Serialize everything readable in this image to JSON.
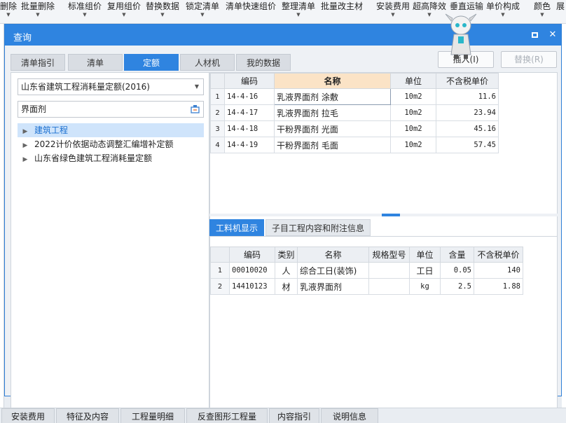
{
  "ribbon": {
    "items": [
      {
        "label": "删除",
        "caret": true
      },
      {
        "label": "批量删除",
        "caret": true
      },
      {
        "label": "标准组价",
        "caret": true
      },
      {
        "label": "复用组价",
        "caret": true
      },
      {
        "label": "替换数据",
        "caret": true
      },
      {
        "label": "锁定清单",
        "caret": true
      },
      {
        "label": "清单快速组价",
        "caret": false
      },
      {
        "label": "整理清单",
        "caret": true
      },
      {
        "label": "批量改主材",
        "caret": false
      },
      {
        "label": "安装费用",
        "caret": true
      },
      {
        "label": "超高降效",
        "caret": true
      },
      {
        "label": "垂直运输",
        "caret": false
      },
      {
        "label": "单价构成",
        "caret": true
      },
      {
        "label": "颜色",
        "caret": true
      },
      {
        "label": "展",
        "caret": false
      }
    ]
  },
  "dialog": {
    "title": "查询",
    "tabs": [
      "清单指引",
      "清单",
      "定额",
      "人材机",
      "我的数据"
    ],
    "active_tab": "定额",
    "insert_button": "插入(I)",
    "replace_button": "替换(R)",
    "library_select": "山东省建筑工程消耗量定额(2016)",
    "search_value": "界面剂",
    "tree": [
      {
        "label": "建筑工程",
        "selected": true
      },
      {
        "label": "2022计价依据动态调整汇编增补定额",
        "selected": false
      },
      {
        "label": "山东省绿色建筑工程消耗量定额",
        "selected": false
      }
    ],
    "grid1": {
      "headers": [
        "",
        "编码",
        "名称",
        "单位",
        "不含税单价"
      ],
      "rows": [
        {
          "idx": "1",
          "code": "14-4-16",
          "name": "乳液界面剂 涂敷",
          "unit": "10m2",
          "price": "11.6"
        },
        {
          "idx": "2",
          "code": "14-4-17",
          "name": "乳液界面剂 拉毛",
          "unit": "10m2",
          "price": "23.94"
        },
        {
          "idx": "3",
          "code": "14-4-18",
          "name": "干粉界面剂 光面",
          "unit": "10m2",
          "price": "45.16"
        },
        {
          "idx": "4",
          "code": "14-4-19",
          "name": "干粉界面剂 毛面",
          "unit": "10m2",
          "price": "57.45"
        }
      ]
    },
    "lower_tabs": [
      "工料机显示",
      "子目工程内容和附注信息"
    ],
    "grid2": {
      "headers": [
        "",
        "编码",
        "类别",
        "名称",
        "规格型号",
        "单位",
        "含量",
        "不含税单价"
      ],
      "rows": [
        {
          "idx": "1",
          "code": "00010020",
          "type": "人",
          "name": "综合工日(装饰)",
          "spec": "",
          "unit": "工日",
          "qty": "0.05",
          "price": "140"
        },
        {
          "idx": "2",
          "code": "14410123",
          "type": "材",
          "name": "乳液界面剂",
          "spec": "",
          "unit": "kg",
          "qty": "2.5",
          "price": "1.88"
        }
      ]
    }
  },
  "bottom_tabs": [
    "安装费用",
    "特征及内容",
    "工程量明细",
    "反查图形工程量",
    "内容指引",
    "说明信息"
  ],
  "colors": {
    "accent": "#2f84e0",
    "header_highlight": "#fbe3c6",
    "selected_tree": "#cfe4fb"
  }
}
